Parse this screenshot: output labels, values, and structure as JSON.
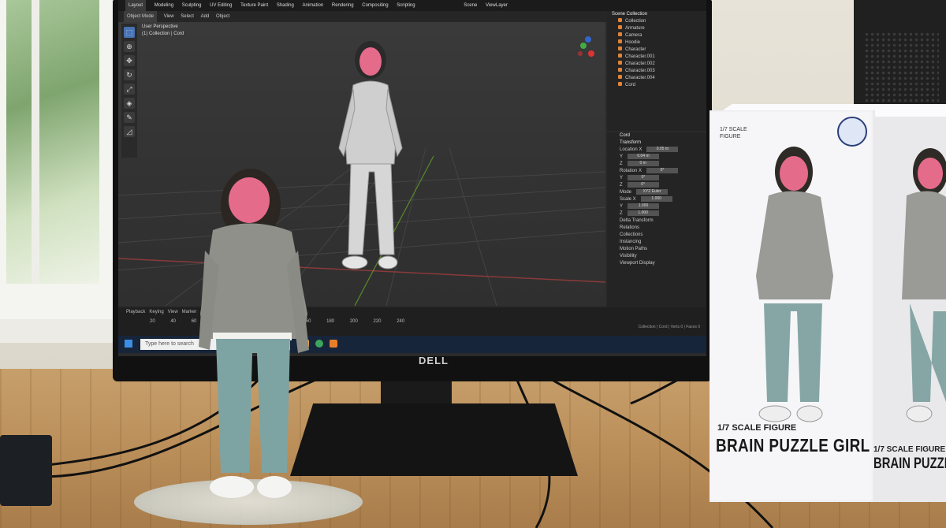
{
  "scene": "desk-setup",
  "colors": {
    "blender_accent": "#4772b3",
    "object_orange": "#e0843a",
    "box_text": "#1a1a1a",
    "brain_pink": "#e56b8a"
  },
  "blender": {
    "topbar_tabs": [
      "Layout",
      "Modeling",
      "Sculpting",
      "UV Editing",
      "Texture Paint",
      "Shading",
      "Animation",
      "Rendering",
      "Compositing",
      "Scripting"
    ],
    "mode_label": "Object Mode",
    "menu_items": [
      "View",
      "Select",
      "Add",
      "Object"
    ],
    "viewport_title": "User Perspective",
    "viewport_subtitle": "(1) Collection | Cord",
    "scene_label": "Scene",
    "view_layer_label": "ViewLayer",
    "outliner_header": "Scene Collection",
    "outliner_items": [
      "Collection",
      "Armature",
      "Camera",
      "Hoodie",
      "Character",
      "Character.001",
      "Character.002",
      "Character.003",
      "Character.004",
      "Cord"
    ],
    "properties": {
      "tab_label": "Cord",
      "section": "Transform",
      "location_label": "Location X",
      "location_values": [
        "0.05 m",
        "0.04 m",
        "0 m"
      ],
      "rotation_label": "Rotation X",
      "rotation_values": [
        "0°",
        "0°",
        "0°"
      ],
      "mode_label": "Mode",
      "mode_value": "XYZ Euler",
      "scale_label": "Scale X",
      "scale_values": [
        "1.000",
        "1.000",
        "1.000"
      ],
      "sections": [
        "Delta Transform",
        "Relations",
        "Collections",
        "Instancing",
        "Motion Paths",
        "Visibility",
        "Viewport Display"
      ]
    },
    "timeline_labels": [
      "Playback",
      "Keying",
      "View",
      "Marker"
    ],
    "timeline_frames": [
      "20",
      "40",
      "60",
      "80",
      "100",
      "120",
      "140",
      "160",
      "180",
      "200",
      "220",
      "240"
    ],
    "search_placeholder": "Type here to search",
    "status_text": "Collection | Cord | Verts 0 | Faces 0"
  },
  "monitor_brand": "DELL",
  "box": {
    "small_text": "1/7 SCALE FIGURE",
    "scale_line": "1/7 SCALE FIGURE",
    "name": "BRAIN PUZZLE GIRL",
    "side_scale": "1/7 SCALE FIGURE",
    "side_name": "BRAIN PUZZLE GIRL"
  }
}
